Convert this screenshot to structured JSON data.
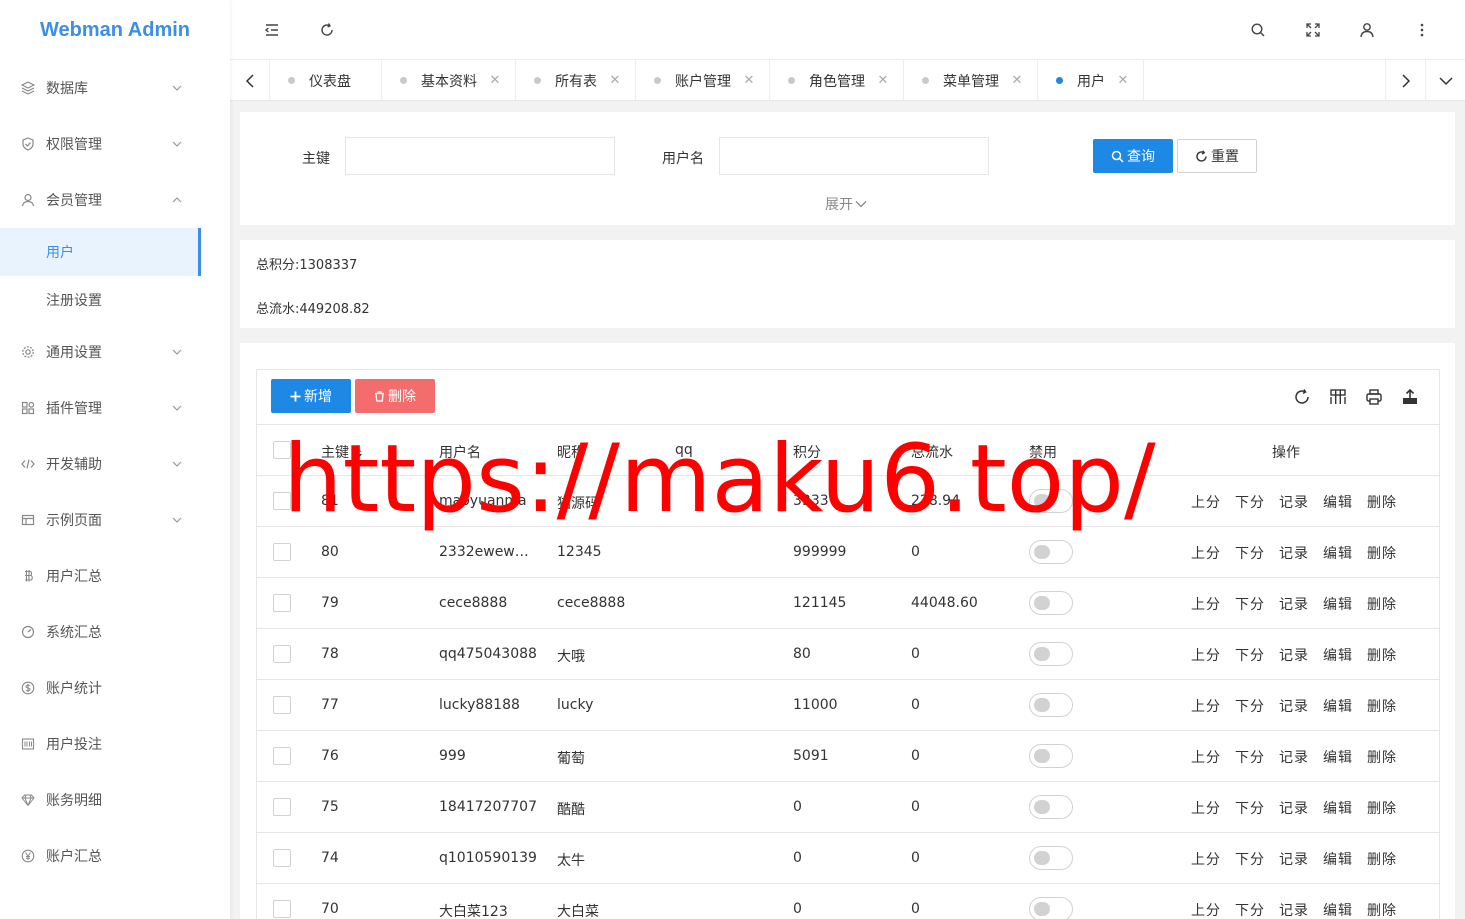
{
  "app": {
    "title": "Webman Admin"
  },
  "sidebar": {
    "items": [
      {
        "label": "数据库",
        "icon": "layers-icon",
        "chevron": "down"
      },
      {
        "label": "权限管理",
        "icon": "shield-icon",
        "chevron": "down"
      },
      {
        "label": "会员管理",
        "icon": "user-icon",
        "chevron": "up"
      },
      {
        "label": "通用设置",
        "icon": "gear-icon",
        "chevron": "down"
      },
      {
        "label": "插件管理",
        "icon": "apps-icon",
        "chevron": "down"
      },
      {
        "label": "开发辅助",
        "icon": "code-icon",
        "chevron": "down"
      },
      {
        "label": "示例页面",
        "icon": "template-icon",
        "chevron": "down"
      },
      {
        "label": "用户汇总",
        "icon": "bitcoin-icon"
      },
      {
        "label": "系统汇总",
        "icon": "gauge-icon"
      },
      {
        "label": "账户统计",
        "icon": "dollar-icon"
      },
      {
        "label": "用户投注",
        "icon": "ticket-icon"
      },
      {
        "label": "账务明细",
        "icon": "diamond-icon"
      },
      {
        "label": "账户汇总",
        "icon": "yen-icon"
      }
    ],
    "sub_items": [
      {
        "label": "用户",
        "active": true
      },
      {
        "label": "注册设置",
        "active": false
      }
    ]
  },
  "tabs": [
    {
      "label": "仪表盘",
      "closable": false,
      "active": false
    },
    {
      "label": "基本资料",
      "closable": true,
      "active": false
    },
    {
      "label": "所有表",
      "closable": true,
      "active": false
    },
    {
      "label": "账户管理",
      "closable": true,
      "active": false
    },
    {
      "label": "角色管理",
      "closable": true,
      "active": false
    },
    {
      "label": "菜单管理",
      "closable": true,
      "active": false
    },
    {
      "label": "用户",
      "closable": true,
      "active": true
    }
  ],
  "search": {
    "id_label": "主键",
    "id_value": "",
    "username_label": "用户名",
    "username_value": "",
    "query_label": "查询",
    "reset_label": "重置",
    "expand_label": "展开"
  },
  "totals": {
    "points": "总积分:1308337",
    "flow": "总流水:449208.82"
  },
  "toolbar": {
    "add_label": "新增",
    "delete_label": "删除"
  },
  "table": {
    "headers": {
      "id": "主键",
      "username": "用户名",
      "nickname": "昵称",
      "qq": "qq",
      "points": "积分",
      "flow": "总流水",
      "disabled": "禁用",
      "ops": "操作"
    },
    "ops": [
      "上分",
      "下分",
      "记录",
      "编辑",
      "删除"
    ],
    "rows": [
      {
        "id": "81",
        "username": "maoyuanma",
        "nickname": "猫源码",
        "qq": "",
        "points": "3333",
        "flow": "228.94",
        "disabled": false
      },
      {
        "id": "80",
        "username": "2332ewew…",
        "nickname": "12345",
        "qq": "",
        "points": "999999",
        "flow": "0",
        "disabled": false
      },
      {
        "id": "79",
        "username": "cece8888",
        "nickname": "cece8888",
        "qq": "",
        "points": "121145",
        "flow": "44048.60",
        "disabled": false
      },
      {
        "id": "78",
        "username": "qq475043088",
        "nickname": "大哦",
        "qq": "",
        "points": "80",
        "flow": "0",
        "disabled": false
      },
      {
        "id": "77",
        "username": "lucky88188",
        "nickname": "lucky",
        "qq": "",
        "points": "11000",
        "flow": "0",
        "disabled": false
      },
      {
        "id": "76",
        "username": "999",
        "nickname": "葡萄",
        "qq": "",
        "points": "5091",
        "flow": "0",
        "disabled": false
      },
      {
        "id": "75",
        "username": "18417207707",
        "nickname": "酷酷",
        "qq": "",
        "points": "0",
        "flow": "0",
        "disabled": false
      },
      {
        "id": "74",
        "username": "q1010590139",
        "nickname": "太牛",
        "qq": "",
        "points": "0",
        "flow": "0",
        "disabled": false
      },
      {
        "id": "70",
        "username": "大白菜123",
        "nickname": "大白菜",
        "qq": "",
        "points": "0",
        "flow": "0",
        "disabled": false
      }
    ]
  },
  "watermark": {
    "text": "https://maku6.top/",
    "color": "#ff0000"
  },
  "colors": {
    "accent": "#1e88e5",
    "danger": "#f56c6c",
    "logo": "#3c8ee6"
  }
}
